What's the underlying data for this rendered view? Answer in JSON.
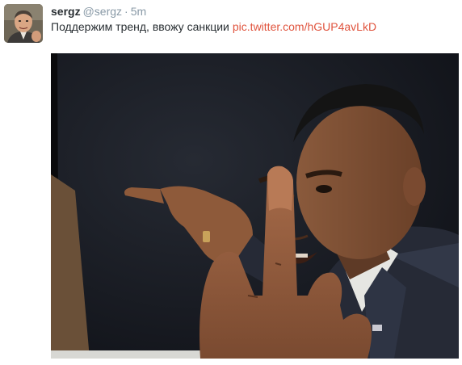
{
  "tweet": {
    "fullname": "sergz",
    "username": "@sergz",
    "separator": "·",
    "time": "5m",
    "text": "Поддержим тренд, ввожу санкции",
    "link": "pic.twitter.com/hGUP4avLkD"
  },
  "colors": {
    "link": "#e0543e",
    "name": "#292f33",
    "muted": "#8899a6"
  },
  "icons": {
    "avatar": "user-avatar-photo",
    "media": "attached-photo"
  }
}
